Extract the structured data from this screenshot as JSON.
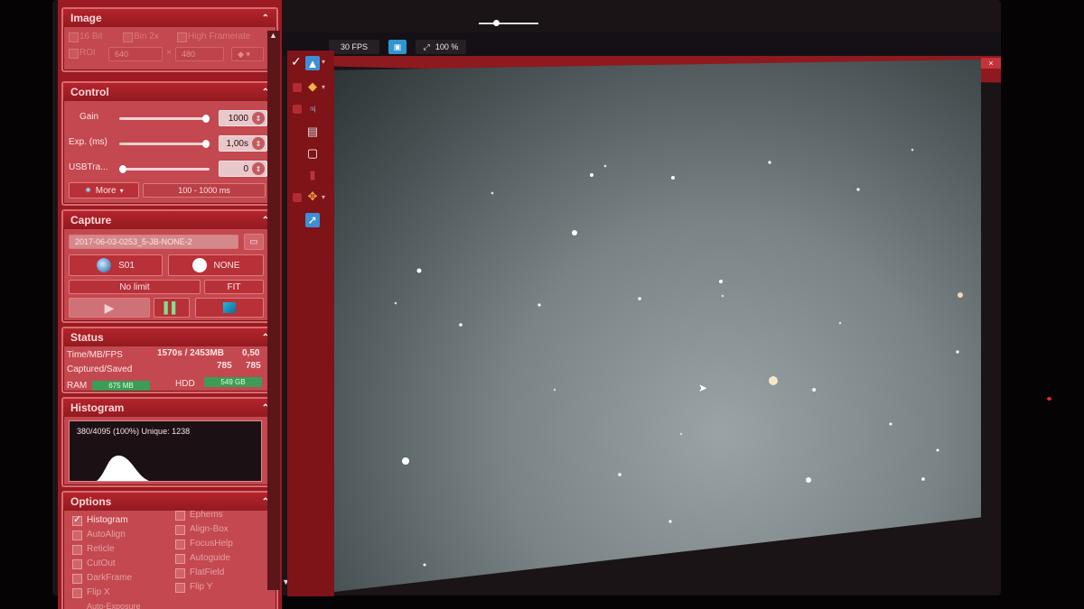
{
  "sections": {
    "image": {
      "title": "Image",
      "opts": [
        "16 Bit",
        "Bin 2x",
        "High Framerate"
      ],
      "roi_label": "ROI",
      "roi_width": "640",
      "roi_sep": "×",
      "roi_height": "480"
    },
    "control": {
      "title": "Control",
      "gain_label": "Gain",
      "gain_value": "1000",
      "gain_level": 0.97,
      "exp_label": "Exp. (ms)",
      "exp_value": "1,00s",
      "exp_level": 0.97,
      "usb_label": "USBTra...",
      "usb_value": "0",
      "usb_level": 0.0,
      "more_label": "More",
      "range_label": "100 - 1000 ms"
    },
    "capture": {
      "title": "Capture",
      "filename": "2017-06-03-0253_5-JB-NONE-2",
      "object_label": "S01",
      "filter_label": "NONE",
      "limit_label": "No limit",
      "format_label": "FIT"
    },
    "status": {
      "title": "Status",
      "time_label": "Time/MB/FPS",
      "time_value": "1570s / 2453MB",
      "fps_value": "0,50",
      "captured_label": "Captured/Saved",
      "captured_value": "785",
      "saved_value": "785",
      "ram_label": "RAM",
      "ram_value": "675 MB",
      "hdd_label": "HDD",
      "hdd_value": "549 GB"
    },
    "histogram": {
      "title": "Histogram",
      "info": "380/4095 (100%) Unique: 1238"
    },
    "options": {
      "title": "Options",
      "left": [
        "Histogram",
        "AutoAlign",
        "Reticle",
        "CutOut",
        "DarkFrame",
        "Flip X",
        "Auto-Exposure"
      ],
      "right": [
        "Ephems",
        "Align-Box",
        "FocusHelp",
        "Autoguide",
        "FlatField",
        "Flip Y"
      ],
      "checked": [
        "Histogram"
      ]
    }
  },
  "topbar": {
    "fps": "30 FPS",
    "zoom": "100 %"
  },
  "window": {
    "close_label": "×"
  },
  "icons": {
    "collapse": "chevron-up-double",
    "spin": "spin-arrows",
    "play": "play-icon",
    "cursor": "mouse-pointer"
  }
}
